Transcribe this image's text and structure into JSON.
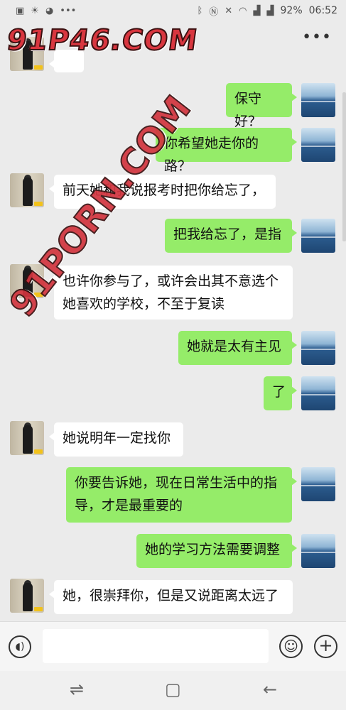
{
  "status_bar": {
    "battery": "92%",
    "time": "06:52",
    "left_icons": [
      "image-icon",
      "weather-icon",
      "app-icon",
      "more-notifications-icon"
    ],
    "right_icons": [
      "bluetooth-icon",
      "nfc-icon",
      "mute-icon",
      "wifi-icon",
      "signal-icon",
      "signal-icon"
    ]
  },
  "header": {
    "more_icon": "more-icon"
  },
  "watermarks": {
    "top": "91P46.COM",
    "diagonal": "91PORN.COM"
  },
  "messages": [
    {
      "from": "other",
      "text": ""
    },
    {
      "from": "me",
      "text": "保守好？"
    },
    {
      "from": "me",
      "text": "你希望她走你的路？"
    },
    {
      "from": "other",
      "text": "前天她和我说报考时把你给忘了，"
    },
    {
      "from": "me",
      "text": "把我给忘了，是指"
    },
    {
      "from": "other",
      "text": "也许你参与了，或许会出其不意选个她喜欢的学校，不至于复读"
    },
    {
      "from": "me",
      "text": "她就是太有主见"
    },
    {
      "from": "me",
      "text": "了"
    },
    {
      "from": "other",
      "text": "她说明年一定找你"
    },
    {
      "from": "me",
      "text": "你要告诉她，现在日常生活中的指导，才是最重要的"
    },
    {
      "from": "me",
      "text": "她的学习方法需要调整"
    },
    {
      "from": "other",
      "text": "她，很崇拜你，但是又说距离太远了"
    }
  ],
  "input_bar": {
    "placeholder": "",
    "voice_icon": "voice-icon",
    "emoji_icon": "emoji-icon",
    "plus_icon": "plus-icon"
  },
  "nav_bar": {
    "icons": [
      "recents-icon",
      "home-icon",
      "back-icon"
    ]
  }
}
